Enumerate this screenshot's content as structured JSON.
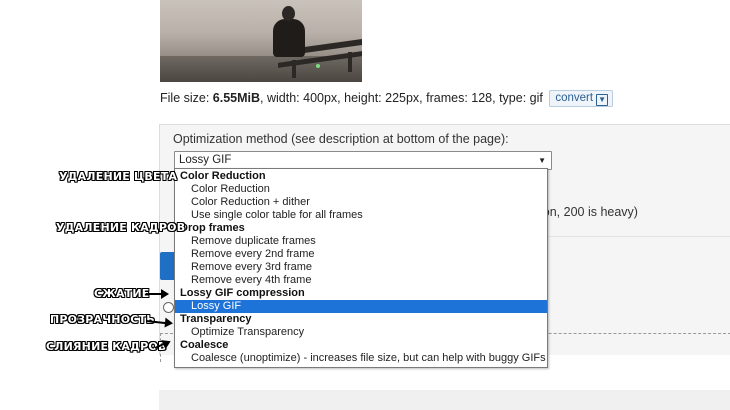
{
  "file_info": {
    "prefix": "File size: ",
    "size": "6.55MiB",
    "details": ", width: 400px, height: 225px, frames: 128, type: gif",
    "convert_label": "convert"
  },
  "optimization": {
    "label": "Optimization method (see description at bottom of the page):",
    "selected": "Lossy GIF",
    "partial_hint": "ion, 200 is heavy)"
  },
  "dropdown": {
    "groups": [
      {
        "label": "Color Reduction",
        "options": [
          "Color Reduction",
          "Color Reduction + dither",
          "Use single color table for all frames"
        ]
      },
      {
        "label": "Drop frames",
        "options": [
          "Remove duplicate frames",
          "Remove every 2nd frame",
          "Remove every 3rd frame",
          "Remove every 4th frame"
        ]
      },
      {
        "label": "Lossy GIF compression",
        "options": [
          "Lossy GIF"
        ]
      },
      {
        "label": "Transparency",
        "options": [
          "Optimize Transparency"
        ]
      },
      {
        "label": "Coalesce",
        "options": [
          "Coalesce (unoptimize) - increases file size, but can help with buggy GIFs"
        ]
      }
    ],
    "selected_option": "Lossy GIF"
  },
  "annotations": {
    "color_removal": "УДАЛЕНИЕ ЦВЕТА",
    "frame_removal": "УДАЛЕНИЕ КАДРОВ",
    "compression": "СЖАТИЕ",
    "transparency": "ПРОЗРАЧНОСТЬ",
    "frame_merge": "СЛИЯНИЕ КАДРОВ"
  },
  "colors": {
    "highlight": "#1e73d8",
    "button": "#1f6fc4"
  }
}
